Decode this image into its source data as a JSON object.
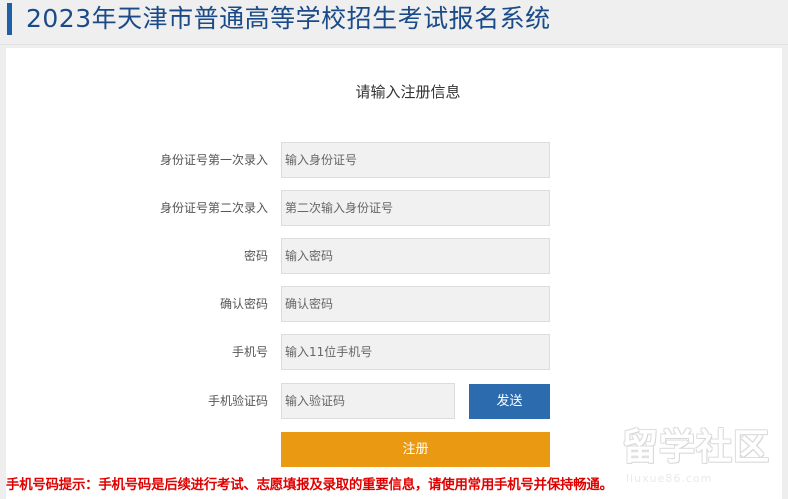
{
  "header": {
    "title": "2023年天津市普通高等学校招生考试报名系统"
  },
  "form": {
    "title": "请输入注册信息",
    "fields": [
      {
        "label": "身份证号第一次录入",
        "placeholder": "输入身份证号"
      },
      {
        "label": "身份证号第二次录入",
        "placeholder": "第二次输入身份证号"
      },
      {
        "label": "密码",
        "placeholder": "输入密码"
      },
      {
        "label": "确认密码",
        "placeholder": "确认密码"
      },
      {
        "label": "手机号",
        "placeholder": "输入11位手机号"
      },
      {
        "label": "手机验证码",
        "placeholder": "输入验证码"
      }
    ],
    "send_label": "发送",
    "register_label": "注册"
  },
  "notice": "手机号码提示：手机号码是后续进行考试、志愿填报及录取的重要信息，请使用常用手机号并保持畅通。",
  "watermark": {
    "logo": "留学社区",
    "url": "liuxue86.com"
  },
  "colors": {
    "brand_blue": "#1a4a88",
    "button_blue": "#2c6cae",
    "register_orange": "#ea9a12",
    "notice_red": "#e00000"
  }
}
